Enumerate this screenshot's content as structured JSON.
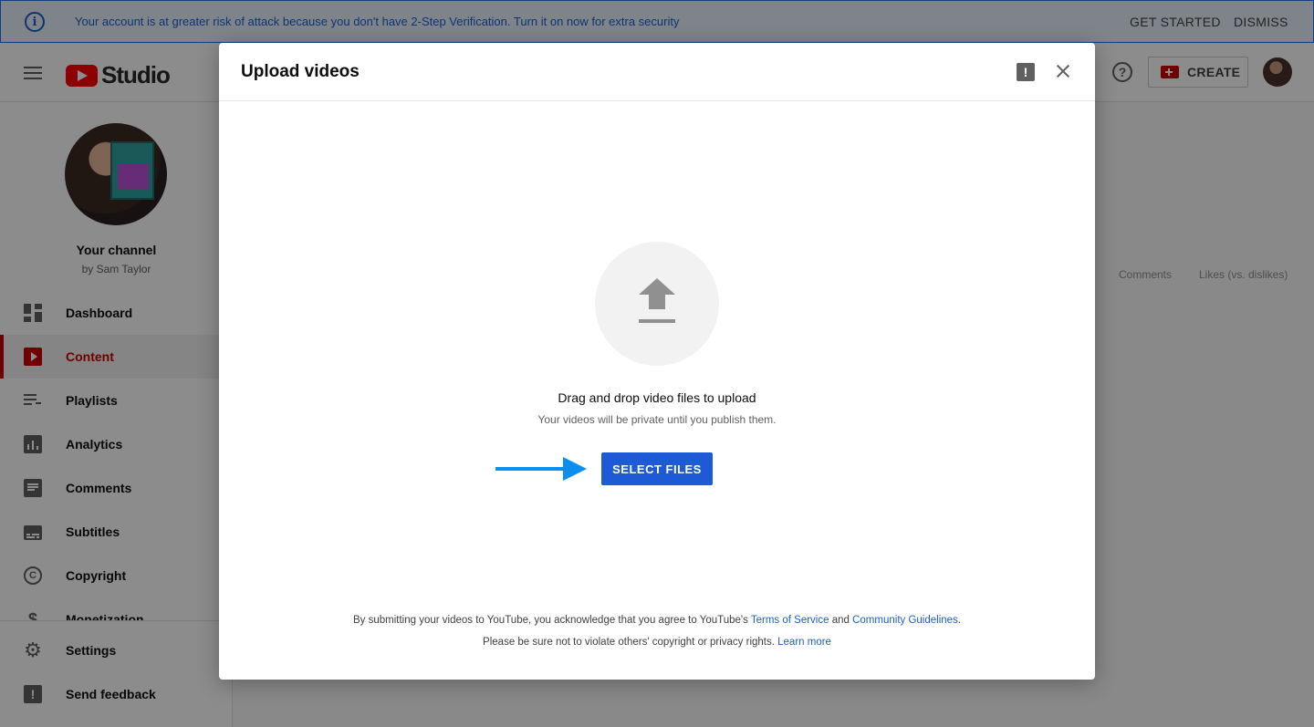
{
  "banner": {
    "message": "Your account is at greater risk of attack because you don't have 2-Step Verification. Turn it on now for extra security",
    "get_started": "GET STARTED",
    "dismiss": "DISMISS"
  },
  "header": {
    "logo_text": "Studio",
    "create_label": "CREATE"
  },
  "sidebar": {
    "channel_name": "Your channel",
    "channel_owner": "by Sam Taylor",
    "items": [
      {
        "label": "Dashboard",
        "icon": "dashboard-icon"
      },
      {
        "label": "Content",
        "icon": "content-icon",
        "active": true
      },
      {
        "label": "Playlists",
        "icon": "playlists-icon"
      },
      {
        "label": "Analytics",
        "icon": "analytics-icon"
      },
      {
        "label": "Comments",
        "icon": "comments-icon"
      },
      {
        "label": "Subtitles",
        "icon": "subtitles-icon"
      },
      {
        "label": "Copyright",
        "icon": "copyright-icon"
      },
      {
        "label": "Monetization",
        "icon": "monetization-icon"
      }
    ],
    "footer_items": [
      {
        "label": "Settings",
        "icon": "gear-icon"
      },
      {
        "label": "Send feedback",
        "icon": "feedback-icon"
      }
    ]
  },
  "background_table": {
    "columns": [
      "Comments",
      "Likes (vs. dislikes)"
    ]
  },
  "dialog": {
    "title": "Upload videos",
    "drag_text": "Drag and drop video files to upload",
    "private_text": "Your videos will be private until you publish them.",
    "select_button": "SELECT FILES",
    "legal_prefix": "By submitting your videos to YouTube, you acknowledge that you agree to YouTube's",
    "terms_link": "Terms of Service",
    "and_text": "and",
    "guidelines_link": "Community Guidelines",
    "period": ".",
    "legal_line2": "Please be sure not to violate others' copyright or privacy rights.",
    "learn_more": "Learn more"
  },
  "colors": {
    "accent": "#1e5ad6",
    "brand_red": "#ff0000",
    "guide_arrow": "#0a8ff0"
  }
}
